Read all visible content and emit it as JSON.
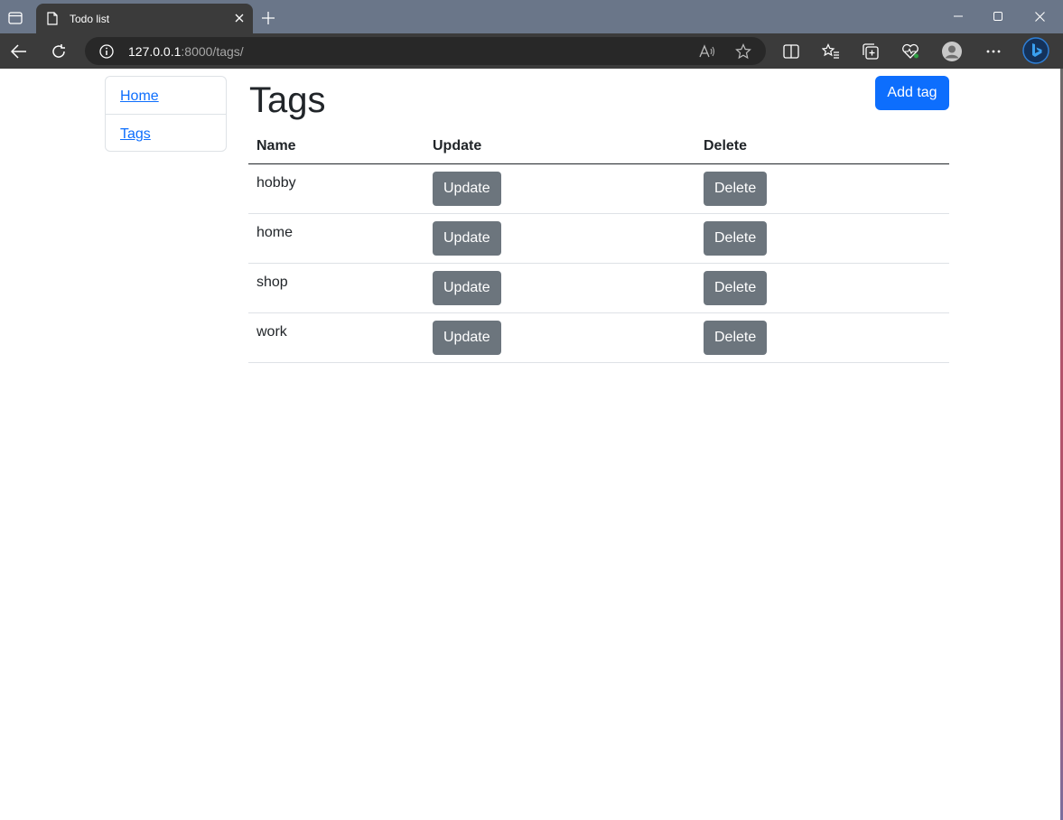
{
  "browser": {
    "tab_title": "Todo list",
    "url_host": "127.0.0.1",
    "url_rest": ":8000/tags/"
  },
  "sidebar": {
    "items": [
      {
        "label": "Home"
      },
      {
        "label": "Tags"
      }
    ]
  },
  "main": {
    "title": "Tags",
    "add_button": "Add tag",
    "table": {
      "columns": [
        "Name",
        "Update",
        "Delete"
      ],
      "rows": [
        {
          "name": "hobby",
          "update": "Update",
          "delete": "Delete"
        },
        {
          "name": "home",
          "update": "Update",
          "delete": "Delete"
        },
        {
          "name": "shop",
          "update": "Update",
          "delete": "Delete"
        },
        {
          "name": "work",
          "update": "Update",
          "delete": "Delete"
        }
      ]
    }
  },
  "colors": {
    "primary": "#0d6efd",
    "secondary": "#6c757d",
    "tabbar": "#6a7689",
    "toolbar": "#3b3b3b"
  }
}
